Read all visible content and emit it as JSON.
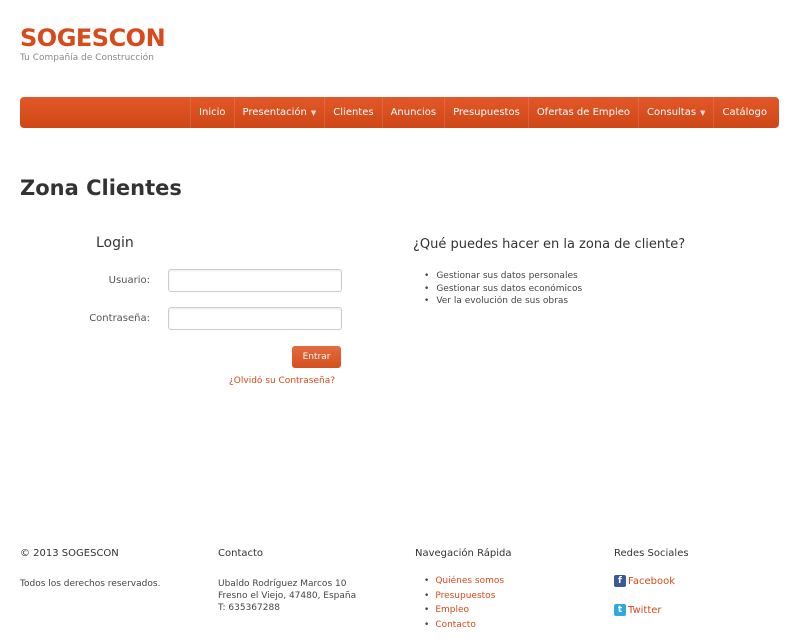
{
  "brand": {
    "name": "SOGESCON",
    "tagline": "Tu Compañía de Construcción"
  },
  "nav": {
    "items": [
      {
        "label": "Inicio",
        "caret": false
      },
      {
        "label": "Presentación",
        "caret": true
      },
      {
        "label": "Clientes",
        "caret": false
      },
      {
        "label": "Anuncios",
        "caret": false
      },
      {
        "label": "Presupuestos",
        "caret": false
      },
      {
        "label": "Ofertas de Empleo",
        "caret": false
      },
      {
        "label": "Consultas",
        "caret": true
      },
      {
        "label": "Catálogo",
        "caret": false
      }
    ],
    "caret_glyph": "▼"
  },
  "page": {
    "title": "Zona Clientes"
  },
  "login": {
    "title": "Login",
    "username_label": "Usuario:",
    "username_value": "",
    "password_label": "Contraseña:",
    "password_value": "",
    "submit_label": "Entrar",
    "forgot_label": "¿Olvidó su Contraseña?"
  },
  "info": {
    "title": "¿Qué puedes hacer en la zona de cliente?",
    "items": [
      "Gestionar sus datos personales",
      "Gestionar sus datos económicos",
      "Ver la evolución de sus obras"
    ]
  },
  "footer": {
    "copyright": {
      "heading": "© 2013 SOGESCON",
      "text": "Todos los derechos reservados."
    },
    "contact": {
      "heading": "Contacto",
      "address1": "Ubaldo Rodríguez Marcos 10",
      "address2": "Fresno el Viejo, 47480, España",
      "phone": "T: 635367288"
    },
    "quick_nav": {
      "heading": "Navegación Rápida",
      "links": [
        "Quiénes somos",
        "Presupuestos",
        "Empleo",
        "Contacto"
      ]
    },
    "social": {
      "heading": "Redes Sociales",
      "facebook": "Facebook",
      "twitter": "Twitter",
      "facebook_icon": "facebook-icon",
      "twitter_icon": "twitter-icon"
    }
  },
  "colors": {
    "accent": "#d84a1b",
    "nav_bg": "#dc5020"
  }
}
